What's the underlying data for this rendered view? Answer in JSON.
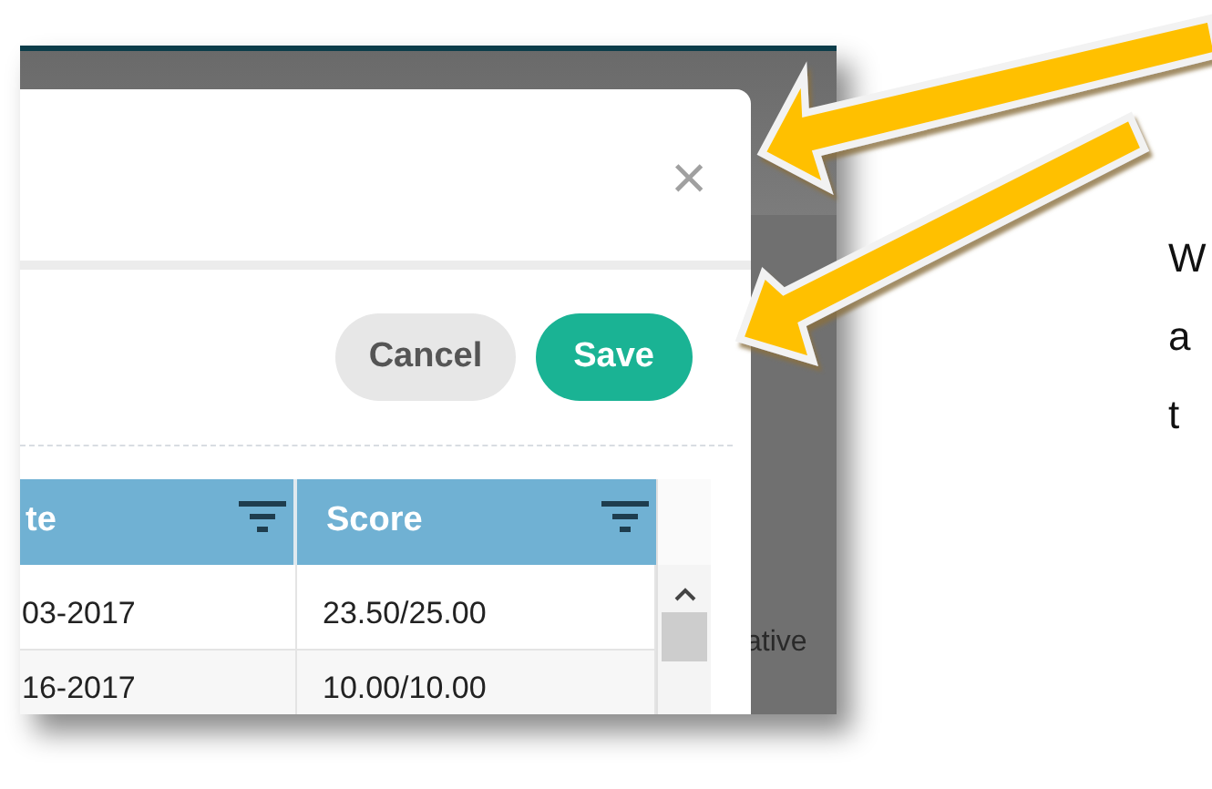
{
  "modal": {
    "close_label": "×",
    "buttons": [
      {
        "label": "Cancel",
        "kind": "secondary"
      },
      {
        "label": "Save",
        "kind": "primary"
      }
    ],
    "table": {
      "columns": [
        {
          "label": "te"
        },
        {
          "label": "Score"
        }
      ],
      "rows": [
        [
          "03-2017",
          "23.50/25.00"
        ],
        [
          "16-2017",
          "10.00/10.00"
        ]
      ]
    }
  },
  "background_text": "ative",
  "side_text": [
    "W",
    "a",
    "t"
  ]
}
